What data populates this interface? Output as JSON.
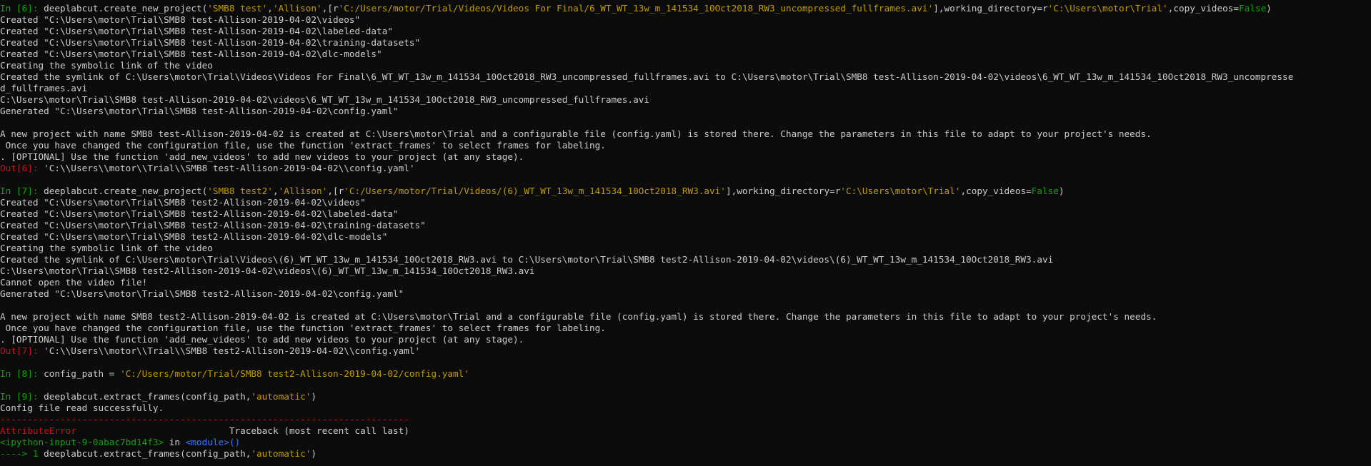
{
  "lines": [
    [
      [
        "g",
        "In [6]: "
      ],
      [
        "c",
        "deeplabcut.create_new_project("
      ],
      [
        "y",
        "'SMB8 test'"
      ],
      [
        "c",
        ","
      ],
      [
        "y",
        "'Allison'"
      ],
      [
        "c",
        ",[r"
      ],
      [
        "y",
        "'C:/Users/motor/Trial/Videos/Videos For Final/6_WT_WT_13w_m_141534_10Oct2018_RW3_uncompressed_fullframes.avi'"
      ],
      [
        "c",
        "],working_directory=r"
      ],
      [
        "y",
        "'C:\\Users\\motor\\Trial'"
      ],
      [
        "c",
        ",copy_videos="
      ],
      [
        "g",
        "False"
      ],
      [
        "c",
        ")"
      ]
    ],
    [
      [
        "c",
        "Created \"C:\\Users\\motor\\Trial\\SMB8 test-Allison-2019-04-02\\videos\""
      ]
    ],
    [
      [
        "c",
        "Created \"C:\\Users\\motor\\Trial\\SMB8 test-Allison-2019-04-02\\labeled-data\""
      ]
    ],
    [
      [
        "c",
        "Created \"C:\\Users\\motor\\Trial\\SMB8 test-Allison-2019-04-02\\training-datasets\""
      ]
    ],
    [
      [
        "c",
        "Created \"C:\\Users\\motor\\Trial\\SMB8 test-Allison-2019-04-02\\dlc-models\""
      ]
    ],
    [
      [
        "c",
        "Creating the symbolic link of the video"
      ]
    ],
    [
      [
        "c",
        "Created the symlink of C:\\Users\\motor\\Trial\\Videos\\Videos For Final\\6_WT_WT_13w_m_141534_10Oct2018_RW3_uncompressed_fullframes.avi to C:\\Users\\motor\\Trial\\SMB8 test-Allison-2019-04-02\\videos\\6_WT_WT_13w_m_141534_10Oct2018_RW3_uncompresse"
      ]
    ],
    [
      [
        "c",
        "d_fullframes.avi"
      ]
    ],
    [
      [
        "c",
        "C:\\Users\\motor\\Trial\\SMB8 test-Allison-2019-04-02\\videos\\6_WT_WT_13w_m_141534_10Oct2018_RW3_uncompressed_fullframes.avi"
      ]
    ],
    [
      [
        "c",
        "Generated \"C:\\Users\\motor\\Trial\\SMB8 test-Allison-2019-04-02\\config.yaml\""
      ]
    ],
    [],
    [
      [
        "c",
        "A new project with name SMB8 test-Allison-2019-04-02 is created at C:\\Users\\motor\\Trial and a configurable file (config.yaml) is stored there. Change the parameters in this file to adapt to your project's needs."
      ]
    ],
    [
      [
        "c",
        " Once you have changed the configuration file, use the function 'extract_frames' to select frames for labeling."
      ]
    ],
    [
      [
        "c",
        ". [OPTIONAL] Use the function 'add_new_videos' to add new videos to your project (at any stage)."
      ]
    ],
    [
      [
        "r",
        "Out[6]: "
      ],
      [
        "c",
        "'C:\\\\Users\\\\motor\\\\Trial\\\\SMB8 test-Allison-2019-04-02\\\\config.yaml'"
      ]
    ],
    [],
    [
      [
        "g",
        "In [7]: "
      ],
      [
        "c",
        "deeplabcut.create_new_project("
      ],
      [
        "y",
        "'SMB8 test2'"
      ],
      [
        "c",
        ","
      ],
      [
        "y",
        "'Allison'"
      ],
      [
        "c",
        ",[r"
      ],
      [
        "y",
        "'C:/Users/motor/Trial/Videos/(6)_WT_WT_13w_m_141534_10Oct2018_RW3.avi'"
      ],
      [
        "c",
        "],working_directory=r"
      ],
      [
        "y",
        "'C:\\Users\\motor\\Trial'"
      ],
      [
        "c",
        ",copy_videos="
      ],
      [
        "g",
        "False"
      ],
      [
        "c",
        ")"
      ]
    ],
    [
      [
        "c",
        "Created \"C:\\Users\\motor\\Trial\\SMB8 test2-Allison-2019-04-02\\videos\""
      ]
    ],
    [
      [
        "c",
        "Created \"C:\\Users\\motor\\Trial\\SMB8 test2-Allison-2019-04-02\\labeled-data\""
      ]
    ],
    [
      [
        "c",
        "Created \"C:\\Users\\motor\\Trial\\SMB8 test2-Allison-2019-04-02\\training-datasets\""
      ]
    ],
    [
      [
        "c",
        "Created \"C:\\Users\\motor\\Trial\\SMB8 test2-Allison-2019-04-02\\dlc-models\""
      ]
    ],
    [
      [
        "c",
        "Creating the symbolic link of the video"
      ]
    ],
    [
      [
        "c",
        "Created the symlink of C:\\Users\\motor\\Trial\\Videos\\(6)_WT_WT_13w_m_141534_10Oct2018_RW3.avi to C:\\Users\\motor\\Trial\\SMB8 test2-Allison-2019-04-02\\videos\\(6)_WT_WT_13w_m_141534_10Oct2018_RW3.avi"
      ]
    ],
    [
      [
        "c",
        "C:\\Users\\motor\\Trial\\SMB8 test2-Allison-2019-04-02\\videos\\(6)_WT_WT_13w_m_141534_10Oct2018_RW3.avi"
      ]
    ],
    [
      [
        "c",
        "Cannot open the video file!"
      ]
    ],
    [
      [
        "c",
        "Generated \"C:\\Users\\motor\\Trial\\SMB8 test2-Allison-2019-04-02\\config.yaml\""
      ]
    ],
    [],
    [
      [
        "c",
        "A new project with name SMB8 test2-Allison-2019-04-02 is created at C:\\Users\\motor\\Trial and a configurable file (config.yaml) is stored there. Change the parameters in this file to adapt to your project's needs."
      ]
    ],
    [
      [
        "c",
        " Once you have changed the configuration file, use the function 'extract_frames' to select frames for labeling."
      ]
    ],
    [
      [
        "c",
        ". [OPTIONAL] Use the function 'add_new_videos' to add new videos to your project (at any stage)."
      ]
    ],
    [
      [
        "r",
        "Out[7]: "
      ],
      [
        "c",
        "'C:\\\\Users\\\\motor\\\\Trial\\\\SMB8 test2-Allison-2019-04-02\\\\config.yaml'"
      ]
    ],
    [],
    [
      [
        "g",
        "In [8]: "
      ],
      [
        "c",
        "config_path = "
      ],
      [
        "y",
        "'C:/Users/motor/Trial/SMB8 test2-Allison-2019-04-02/config.yaml'"
      ]
    ],
    [],
    [
      [
        "g",
        "In [9]: "
      ],
      [
        "c",
        "deeplabcut.extract_frames(config_path,"
      ],
      [
        "y",
        "'automatic'"
      ],
      [
        "c",
        ")"
      ]
    ],
    [
      [
        "c",
        "Config file read successfully."
      ]
    ],
    [
      [
        "r",
        "---------------------------------------------------------------------------"
      ]
    ],
    [
      [
        "r",
        "AttributeError"
      ],
      [
        "c",
        "                            Traceback (most recent call last)"
      ]
    ],
    [
      [
        "g",
        "<ipython-input-9-0abac7bd14f3>"
      ],
      [
        "c",
        " in "
      ],
      [
        "b",
        "<module>()"
      ]
    ],
    [
      [
        "g",
        "----> 1 "
      ],
      [
        "c",
        "deeplabcut.extract_frames(config_path,"
      ],
      [
        "y",
        "'automatic'"
      ],
      [
        "c",
        ")"
      ]
    ]
  ]
}
